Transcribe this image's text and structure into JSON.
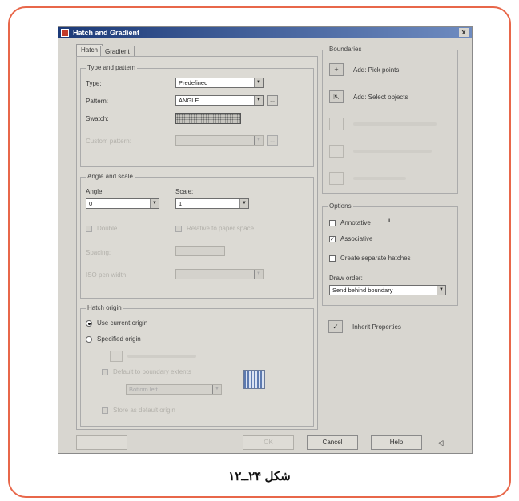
{
  "window": {
    "title": "Hatch and Gradient",
    "close": "x"
  },
  "tabs": {
    "hatch": "Hatch",
    "gradient": "Gradient"
  },
  "type_pattern": {
    "group_title": "Type and pattern",
    "type_label": "Type:",
    "type_value": "Predefined",
    "pattern_label": "Pattern:",
    "pattern_value": "ANGLE",
    "swatch_label": "Swatch:",
    "custom_label": "Custom pattern:",
    "dots": "...",
    "combo_arrow": "▼"
  },
  "angle_scale": {
    "group_title": "Angle and scale",
    "angle_label": "Angle:",
    "angle_value": "0",
    "scale_label": "Scale:",
    "scale_value": "1",
    "double_label": "Double",
    "relative_label": "Relative to paper space",
    "spacing_label": "Spacing:",
    "iso_label": "ISO pen width:"
  },
  "origin": {
    "group_title": "Hatch origin",
    "use_current": "Use current origin",
    "specified": "Specified origin",
    "default_to_extents": "Default to boundary extents",
    "position_value": "Bottom left",
    "store_default": "Store as default origin"
  },
  "boundaries": {
    "group_title": "Boundaries",
    "add_pick": "Add: Pick points",
    "add_select": "Add: Select objects",
    "pick_icon": "+",
    "select_icon": "⇱"
  },
  "options": {
    "group_title": "Options",
    "annotative": "Annotative",
    "info_icon": "i",
    "associative": "Associative",
    "separate": "Create separate hatches",
    "draw_order_label": "Draw order:",
    "draw_order_value": "Send behind boundary",
    "inherit": "Inherit Properties",
    "check_mark": "✓"
  },
  "footer": {
    "ok": "OK",
    "cancel": "Cancel",
    "help": "Help",
    "more": "◁"
  },
  "caption": "شکل ۲۴ــ۱۲"
}
